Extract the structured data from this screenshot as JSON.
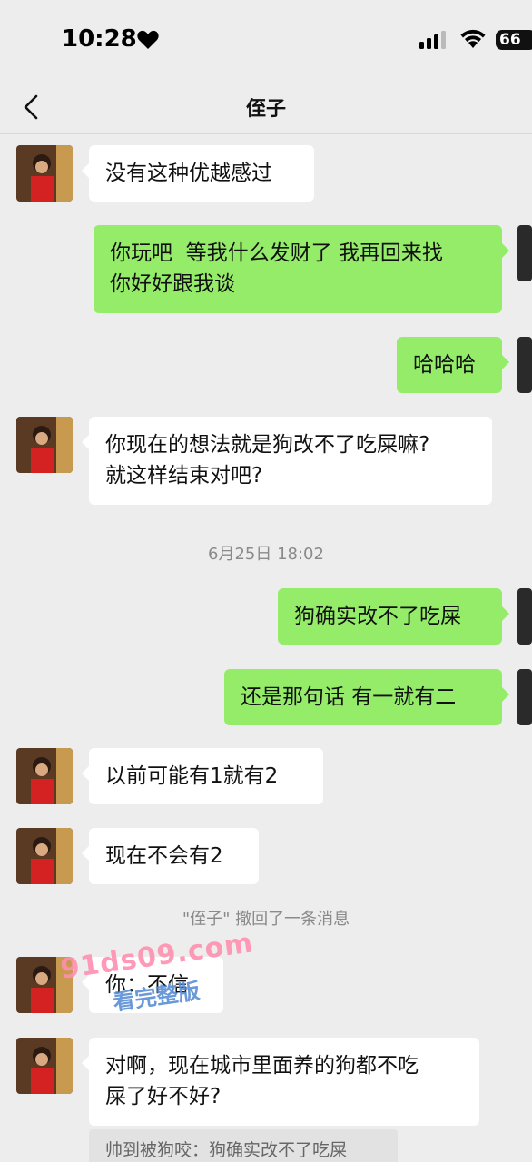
{
  "status_bar": {
    "time": "10:28",
    "battery": "66"
  },
  "nav": {
    "title": "侄子"
  },
  "messages": [
    {
      "side": "in",
      "text": "没有这种优越感过"
    },
    {
      "side": "out",
      "text": "你玩吧  等我什么发财了 我再回来找\n你好好跟我谈"
    },
    {
      "side": "out",
      "text": "哈哈哈"
    },
    {
      "side": "in",
      "text": "你现在的想法就是狗改不了吃屎嘛?\n就这样结束对吧?"
    },
    {
      "side": "out",
      "text": "狗确实改不了吃屎"
    },
    {
      "side": "out",
      "text": "还是那句话 有一就有二"
    },
    {
      "side": "in",
      "text": "以前可能有1就有2"
    },
    {
      "side": "in",
      "text": "现在不会有2"
    },
    {
      "side": "in",
      "text": "你：不信"
    },
    {
      "side": "in",
      "text": "对啊，现在城市里面养的狗都不吃\n屎了好不好?"
    }
  ],
  "timestamp": "6月25日 18:02",
  "recall_notice": "\"侄子\" 撤回了一条消息",
  "quote": "帅到被狗咬：狗确实改不了吃屎",
  "watermark": {
    "line1": "91ds09.com",
    "line2": "看完整版"
  },
  "colors": {
    "out_bubble": "#95ec69",
    "in_bubble": "#ffffff",
    "background": "#ededed"
  },
  "icons": {
    "back": "chevron-left-icon",
    "heart": "heart-icon",
    "signal": "signal-icon",
    "wifi": "wifi-icon"
  }
}
